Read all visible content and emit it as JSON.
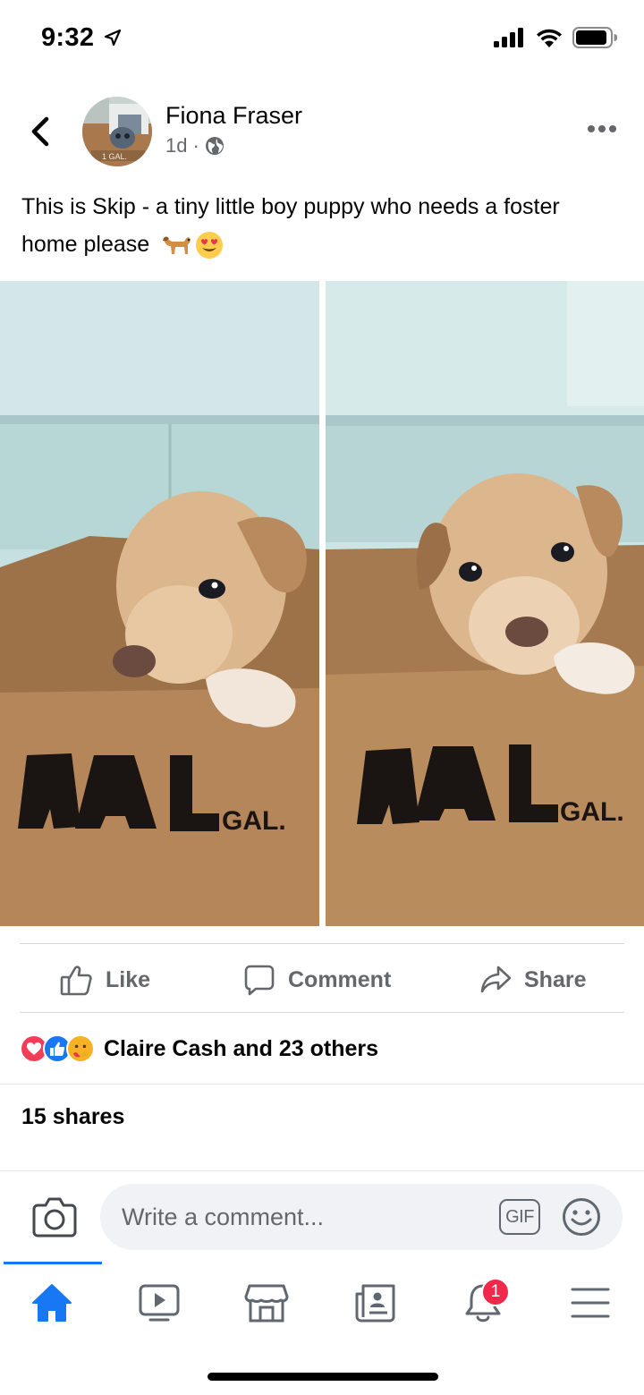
{
  "status": {
    "time": "9:32"
  },
  "post": {
    "author": "Fiona Fraser",
    "age": "1d",
    "separator": "·",
    "text": "This is Skip - a tiny little boy puppy who needs a foster home please",
    "box_label": "GAL.",
    "avatar_box_label": "1 GAL."
  },
  "actions": {
    "like": "Like",
    "comment": "Comment",
    "share": "Share"
  },
  "reactions": {
    "text": "Claire Cash and 23 others"
  },
  "shares": "15 shares",
  "composer": {
    "placeholder": "Write a comment...",
    "gif": "GIF"
  },
  "tabs": {
    "home": "home-icon",
    "watch": "video-icon",
    "marketplace": "marketplace-icon",
    "news": "news-icon",
    "notifications": "bell-icon",
    "notifications_badge": "1",
    "menu": "menu-icon"
  },
  "colors": {
    "accent": "#1877f2",
    "badge": "#f02849",
    "secondary_text": "#65676b"
  }
}
